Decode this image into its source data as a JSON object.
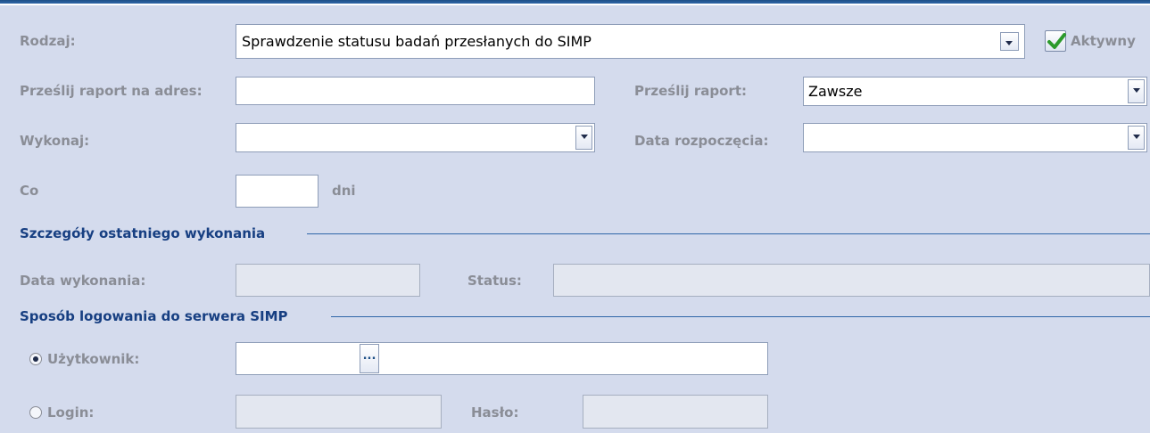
{
  "form": {
    "rodzaj_label": "Rodzaj:",
    "rodzaj_value": "Sprawdzenie statusu badań przesłanych do SIMP",
    "aktywny_label": "Aktywny",
    "aktywny_checked": true,
    "adres_label": "Prześlij raport na adres:",
    "adres_value": "",
    "przeslij_label": "Prześlij raport:",
    "przeslij_value": "Zawsze",
    "wykonaj_label": "Wykonaj:",
    "wykonaj_value": "",
    "data_rozp_label": "Data rozpoczęcia:",
    "data_rozp_value": "",
    "co_label": "Co",
    "co_value": "",
    "dni_label": "dni"
  },
  "last_run": {
    "section_title": "Szczegóły ostatniego wykonania",
    "data_label": "Data wykonania:",
    "data_value": "",
    "status_label": "Status:",
    "status_value": ""
  },
  "login": {
    "section_title": "Sposób logowania do serwera SIMP",
    "uzytkownik_label": "Użytkownik:",
    "uzytkownik_selected": true,
    "uzytkownik_value": "",
    "ellipsis": "...",
    "login_label": "Login:",
    "login_selected": false,
    "login_value": "",
    "haslo_label": "Hasło:",
    "haslo_value": ""
  },
  "colors": {
    "background": "#d4dbed",
    "section_title": "#173f82",
    "label": "#8a8d96",
    "accent": "#2f66a8"
  }
}
